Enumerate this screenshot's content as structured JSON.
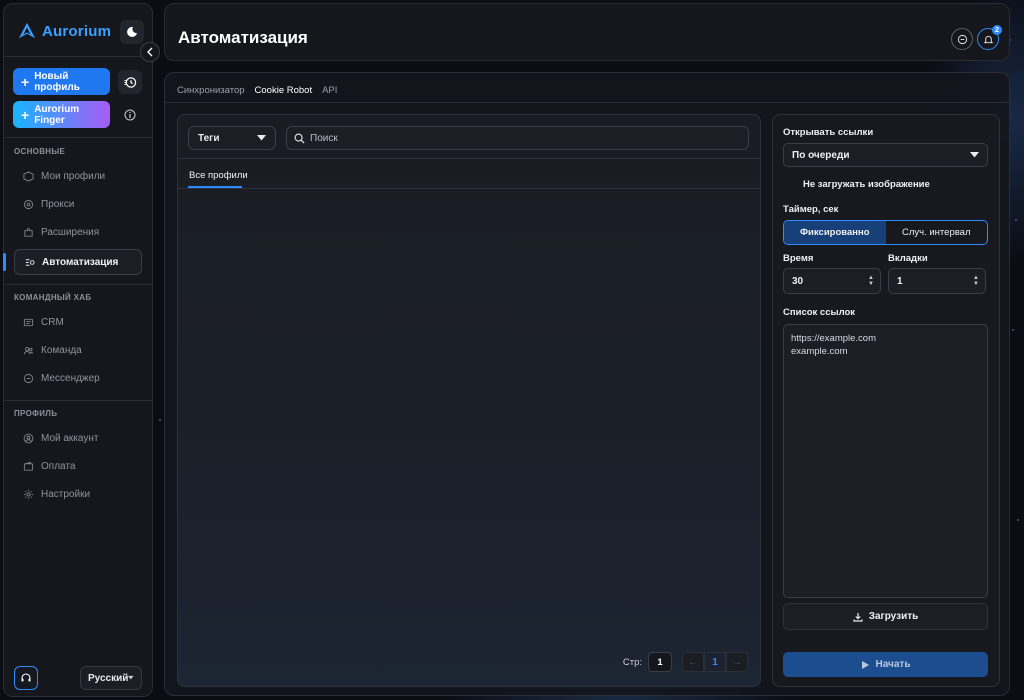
{
  "app": {
    "name": "Aurorium"
  },
  "sidebar": {
    "new_profile_label": "Новый профиль",
    "finger_label": "Aurorium Finger",
    "sections": [
      {
        "title": "ОСНОВНЫЕ",
        "items": [
          {
            "label": "Мои профили",
            "icon": "cube-icon"
          },
          {
            "label": "Прокси",
            "icon": "proxy-icon"
          },
          {
            "label": "Расширения",
            "icon": "puzzle-icon"
          },
          {
            "label": "Автоматизация",
            "icon": "automation-icon",
            "active": true
          }
        ]
      },
      {
        "title": "КОМАНДНЫЙ ХАБ",
        "items": [
          {
            "label": "CRM",
            "icon": "crm-icon"
          },
          {
            "label": "Команда",
            "icon": "team-icon"
          },
          {
            "label": "Мессенджер",
            "icon": "chat-icon"
          }
        ]
      },
      {
        "title": "ПРОФИЛЬ",
        "items": [
          {
            "label": "Мой аккаунт",
            "icon": "user-icon"
          },
          {
            "label": "Оплата",
            "icon": "wallet-icon"
          },
          {
            "label": "Настройки",
            "icon": "gear-icon"
          }
        ]
      }
    ],
    "language": "Русский"
  },
  "header": {
    "title": "Автоматизация",
    "notifications_count": "2"
  },
  "tabs": [
    "Синхронизатор",
    "Cookie Robot",
    "API"
  ],
  "active_tab": "Cookie Robot",
  "left_panel": {
    "tags_label": "Теги",
    "search_placeholder": "Поиск",
    "subtab": "Все профили",
    "pager": {
      "label": "Стр:",
      "page_input": "1",
      "current_page": "1",
      "prev": "←",
      "next": "→"
    }
  },
  "right_panel": {
    "open_links_label": "Открывать ссылки",
    "open_links_value": "По очереди",
    "no_images_label": "Не загружать изображение",
    "timer_label": "Таймер, сек",
    "timer_modes": [
      "Фиксированно",
      "Случ. интервал"
    ],
    "time_label": "Время",
    "time_value": "30",
    "tabs_label": "Вкладки",
    "tabs_value": "1",
    "links_label": "Список ссылок",
    "links": [
      "https://example.com",
      "example.com"
    ],
    "load_label": "Загрузить",
    "start_label": "Начать"
  },
  "colors": {
    "accent": "#2f8bff",
    "background": "#0b0d14",
    "panel": "#15171d"
  }
}
